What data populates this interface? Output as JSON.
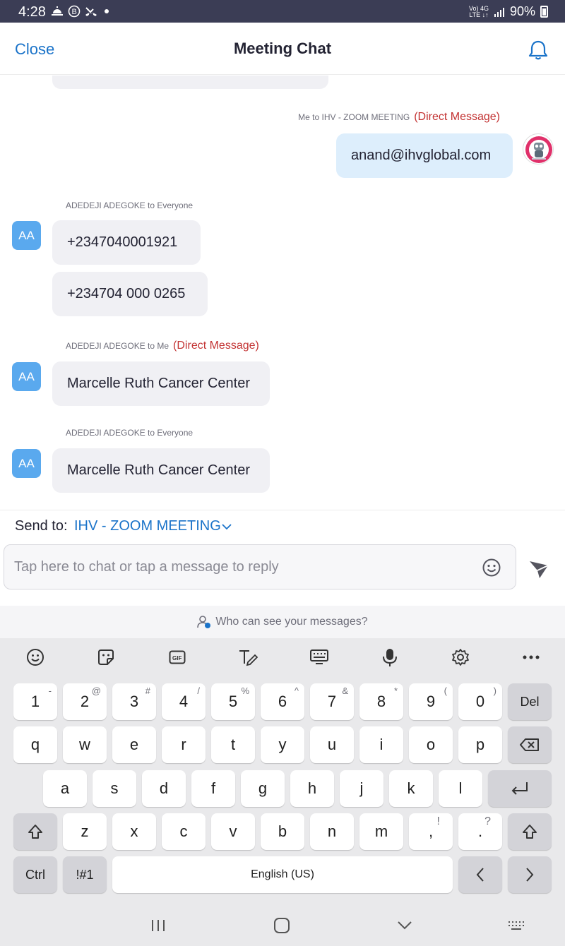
{
  "status_bar": {
    "time": "4:28",
    "network_top": "Vo) 4G",
    "network_bottom": "LTE ↓↑",
    "battery": "90%"
  },
  "header": {
    "close_label": "Close",
    "title": "Meeting Chat",
    "bell_icon": "bell-icon"
  },
  "messages": [
    {
      "meta": "Me to IHV - ZOOM MEETING",
      "tag": "(Direct Message)",
      "text": "anand@ihvglobal.com",
      "mine": true
    },
    {
      "meta": "ADEDEJI ADEGOKE to Everyone",
      "tag": "",
      "avatar": "AA",
      "texts": [
        "+2347040001921",
        "+234704 000 0265"
      ]
    },
    {
      "meta": "ADEDEJI ADEGOKE to Me",
      "tag": "(Direct Message)",
      "avatar": "AA",
      "text": "Marcelle Ruth Cancer Center"
    },
    {
      "meta": "ADEDEJI ADEGOKE to Everyone",
      "tag": "",
      "avatar": "AA",
      "text": "Marcelle Ruth Cancer Center"
    }
  ],
  "composer": {
    "send_to_label": "Send to:",
    "send_to_target": "IHV - ZOOM MEETING",
    "placeholder": "Tap here to chat or tap a message to reply",
    "privacy_text": "Who can see your messages?"
  },
  "keyboard": {
    "number_row": [
      {
        "k": "1",
        "s": "-"
      },
      {
        "k": "2",
        "s": "@"
      },
      {
        "k": "3",
        "s": "#"
      },
      {
        "k": "4",
        "s": "/"
      },
      {
        "k": "5",
        "s": "%"
      },
      {
        "k": "6",
        "s": "^"
      },
      {
        "k": "7",
        "s": "&"
      },
      {
        "k": "8",
        "s": "*"
      },
      {
        "k": "9",
        "s": "("
      },
      {
        "k": "0",
        "s": ")"
      }
    ],
    "del_label": "Del",
    "row_q": [
      "q",
      "w",
      "e",
      "r",
      "t",
      "y",
      "u",
      "i",
      "o",
      "p"
    ],
    "row_a": [
      "a",
      "s",
      "d",
      "f",
      "g",
      "h",
      "j",
      "k",
      "l"
    ],
    "row_z": [
      "z",
      "x",
      "c",
      "v",
      "b",
      "n",
      "m"
    ],
    "comma": {
      "k": ",",
      "s": "!"
    },
    "period": {
      "k": ".",
      "s": "?"
    },
    "ctrl_label": "Ctrl",
    "symbols_label": "!#1",
    "space_label": "English (US)"
  }
}
